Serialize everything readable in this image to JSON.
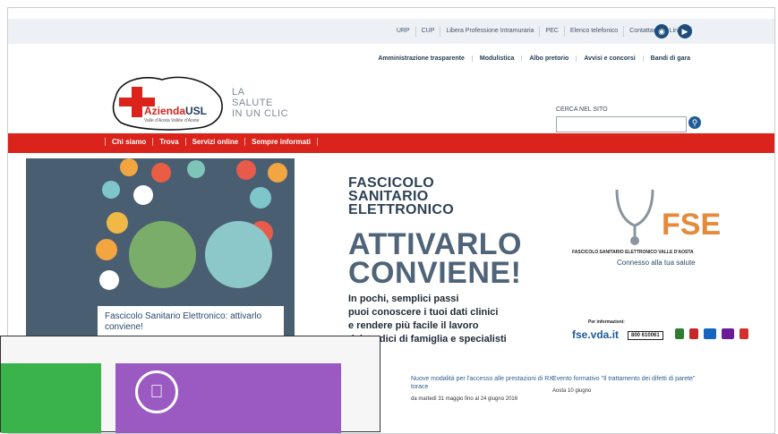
{
  "toplinks": [
    "URP",
    "CUP",
    "Libera Professione Intramuraria",
    "PEC",
    "Elenco telefonico",
    "Contattaci",
    "Link utili"
  ],
  "social": [
    {
      "icon": "twitter-icon"
    },
    {
      "icon": "youtube-icon"
    }
  ],
  "secondary_links": [
    "Amministrazione trasparente",
    "Modulistica",
    "Albo pretorio",
    "Avvisi e concorsi",
    "Bandi di gara"
  ],
  "logo": {
    "brand_left": "Azienda",
    "brand_right": "USL",
    "subline": "Valle d'Aosta Vallée d'Aoste"
  },
  "tagline": [
    "LA",
    "SALUTE",
    "IN UN CLIC"
  ],
  "search": {
    "label": "CERCA NEL SITO",
    "placeholder": ""
  },
  "main_nav": [
    "Chi siamo",
    "Trova",
    "Servizi online",
    "Sempre informati"
  ],
  "banner": {
    "caption": "Fascicolo Sanitario Elettronico: attivarlo conviene!",
    "title_lines": [
      "FASCICOLO",
      "SANITARIO",
      "ELETTRONICO"
    ],
    "big_lines": [
      "ATTIVARLO",
      "CONVIENE!"
    ],
    "desc_lines": [
      "In pochi, semplici passi",
      "puoi conoscere i tuoi dati clinici",
      "e rendere più facile il lavoro",
      "dei medici di famiglia e specialisti"
    ],
    "fse_label": "FASCICOLO SANITARIO ELETTRONICO VALLE D'AOSTA",
    "fse_tagline": "Connesso alla tua salute",
    "info_site": "fse.vda.it",
    "info_label": "Per informazioni:",
    "info_phone": "800 610061"
  },
  "news": [
    {
      "title": "Nuove modalità per l'accesso alle prestazioni di RX torace",
      "date": "da martedì 31 maggio fino al 24 giugno 2016"
    },
    {
      "title": "Evento formativo \"Il trattamento dei difetti di parete\"",
      "date": "Aosta 10 giugno"
    }
  ],
  "colors": {
    "red_nav": "#d9231b",
    "accent_blue": "#1f5c96",
    "tile_green": "#3ab34a",
    "tile_purple": "#9b59c2"
  }
}
